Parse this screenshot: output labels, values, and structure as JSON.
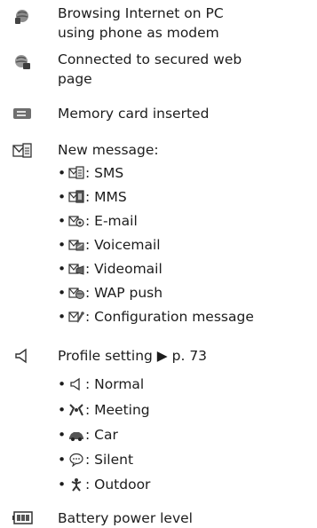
{
  "entries": [
    {
      "icon": "globe-phone-icon",
      "lines": [
        "Browsing Internet on PC",
        "using phone as modem"
      ]
    },
    {
      "icon": "secure-globe-icon",
      "lines": [
        "Connected to secured web",
        "page"
      ]
    },
    {
      "icon": "memory-card-icon",
      "lines": [
        "Memory card inserted"
      ]
    },
    {
      "icon": "new-message-icon",
      "lines": [
        "New message:"
      ]
    },
    {
      "icon": "profile-speaker-icon",
      "lines": [
        "Profile setting ▶ p. 73"
      ]
    },
    {
      "icon": "battery-icon",
      "lines": [
        "Battery power level"
      ]
    }
  ],
  "messages": [
    {
      "icon": "sms-icon",
      "label": ": SMS"
    },
    {
      "icon": "mms-icon",
      "label": ": MMS"
    },
    {
      "icon": "email-icon",
      "label": ": E-mail"
    },
    {
      "icon": "voicemail-icon",
      "label": ": Voicemail"
    },
    {
      "icon": "videomail-icon",
      "label": ": Videomail"
    },
    {
      "icon": "wap-push-icon",
      "label": ": WAP push"
    },
    {
      "icon": "configuration-icon",
      "label": ": Configuration message"
    }
  ],
  "profiles": [
    {
      "icon": "normal-speaker-icon",
      "label": ": Normal"
    },
    {
      "icon": "meeting-icon",
      "label": ": Meeting"
    },
    {
      "icon": "car-icon",
      "label": ": Car"
    },
    {
      "icon": "silent-bubble-icon",
      "label": ": Silent"
    },
    {
      "icon": "outdoor-person-icon",
      "label": ": Outdoor"
    }
  ],
  "bullet": "•"
}
